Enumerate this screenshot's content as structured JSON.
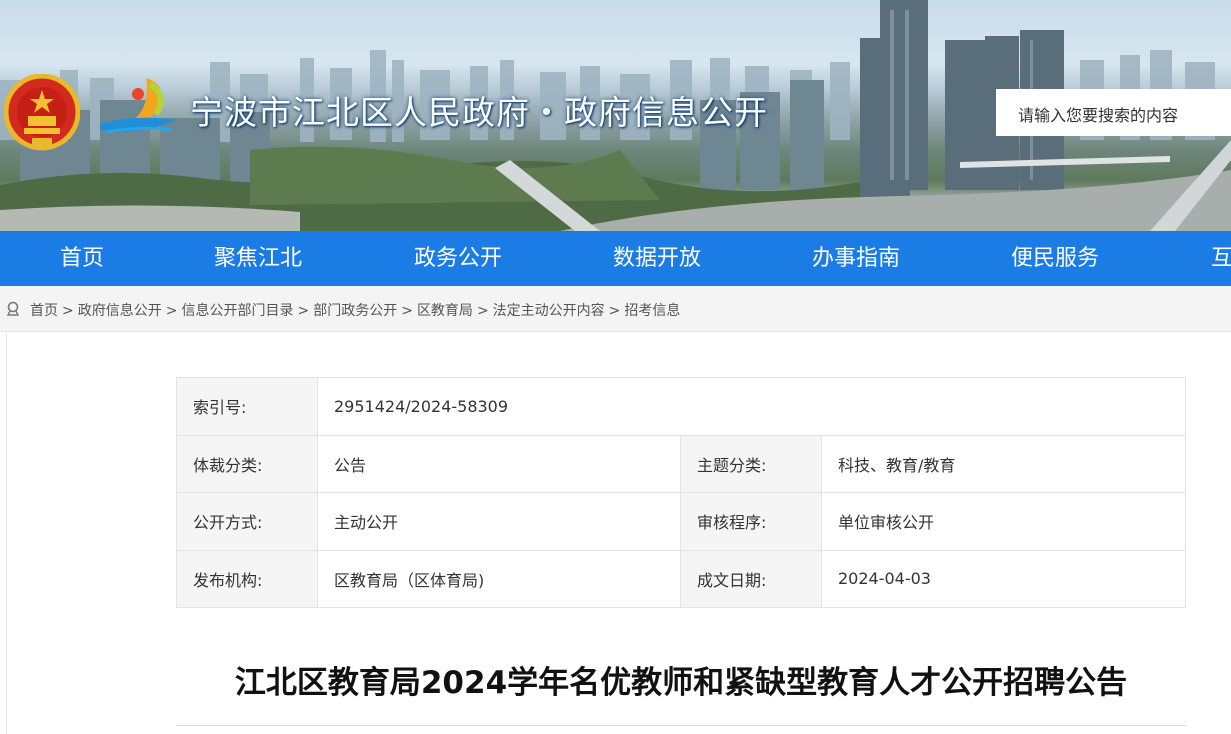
{
  "header": {
    "site_title": "宁波市江北区人民政府・政府信息公开",
    "search_placeholder": "请输入您要搜索的内容"
  },
  "nav": {
    "items": [
      {
        "label": "首页"
      },
      {
        "label": "聚焦江北"
      },
      {
        "label": "政务公开"
      },
      {
        "label": "数据开放"
      },
      {
        "label": "办事指南"
      },
      {
        "label": "便民服务"
      },
      {
        "label": "互"
      }
    ]
  },
  "breadcrumb": {
    "icon": "location-pin-icon",
    "items": [
      "首页",
      "政府信息公开",
      "信息公开部门目录",
      "部门政务公开",
      "区教育局",
      "法定主动公开内容",
      "招考信息"
    ],
    "separator": ">"
  },
  "meta": {
    "index_label": "索引号:",
    "index_value": "2951424/2024-58309",
    "genre_label": "体裁分类:",
    "genre_value": "公告",
    "topic_label": "主题分类:",
    "topic_value": "科技、教育/教育",
    "publicity_label": "公开方式:",
    "publicity_value": "主动公开",
    "review_label": "审核程序:",
    "review_value": "单位审核公开",
    "issuer_label": "发布机构:",
    "issuer_value": "区教育局（区体育局)",
    "date_label": "成文日期:",
    "date_value": "2024-04-03"
  },
  "article": {
    "title": "江北区教育局2024学年名优教师和紧缺型教育人才公开招聘公告"
  },
  "colors": {
    "nav_bg": "#1b7ce6",
    "label_cell_bg": "#f5f5f5",
    "breadcrumb_bg": "#f4f4f4"
  }
}
